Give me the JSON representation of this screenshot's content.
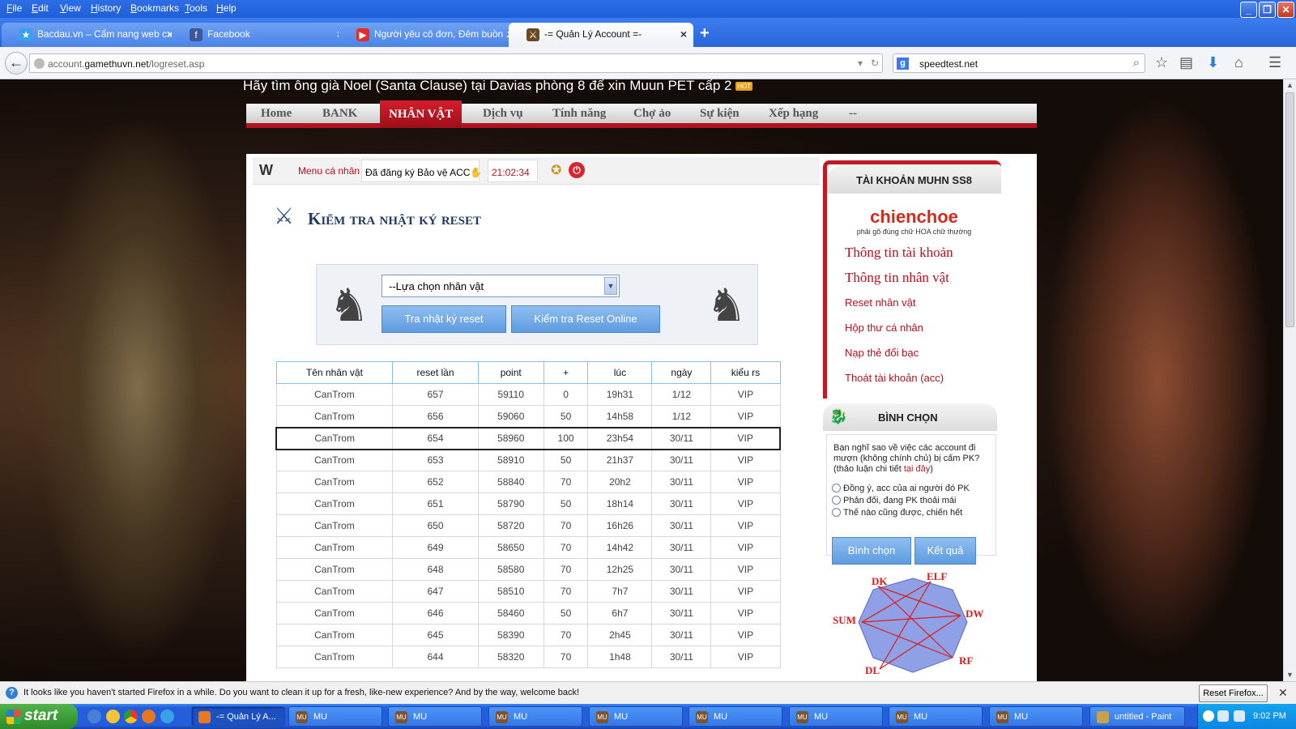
{
  "browser": {
    "menus": [
      "File",
      "Edit",
      "View",
      "History",
      "Bookmarks",
      "Tools",
      "Help"
    ],
    "tabs": [
      {
        "label": "Bacdau.vn – Cẩm nang web c...",
        "icon": "bacdau-favicon"
      },
      {
        "label": "Facebook",
        "icon": "facebook-favicon"
      },
      {
        "label": "Người yêu cô đơn, Đêm buồn ...",
        "icon": "youtube-favicon"
      },
      {
        "label": "-= Quản Lý Account =-",
        "icon": "mu-favicon",
        "active": true
      }
    ],
    "url_prefix": "account.",
    "url_host": "gamethuvn.net",
    "url_path": "/logreset.asp",
    "search_text": "speedtest.net",
    "notification": "It looks like you haven't started Firefox in a while. Do you want to clean it up for a fresh, like-new experience? And by the way, welcome back!",
    "reset_button": "Reset Firefox..."
  },
  "site": {
    "marquee": "Hãy tìm ông già Noel (Santa Clause) tại Davias phòng 8 để xin Muun PET cấp 2",
    "hot_badge": "HOT",
    "nav": [
      "Home",
      "BANK",
      "NHÂN VẬT",
      "Dịch vụ",
      "Tính năng",
      "Chợ ảo",
      "Sự kiện",
      "Xếp hạng",
      "--"
    ],
    "menu_label": "Menu cá nhân",
    "protect_status": "Đã đăng ký Bảo vệ ACC",
    "clock": "21:02:34",
    "page_title": "Kiểm tra nhật ký reset",
    "select_placeholder": "--Lựa chọn nhân vật",
    "btn_log": "Tra nhật ký reset",
    "btn_online": "Kiểm tra Reset Online",
    "table": {
      "headers": [
        "Tên nhân vật",
        "reset lần",
        "point",
        "+",
        "lúc",
        "ngày",
        "kiểu rs"
      ],
      "rows": [
        [
          "CanTrom",
          "657",
          "59110",
          "0",
          "19h31",
          "1/12",
          "VIP"
        ],
        [
          "CanTrom",
          "656",
          "59060",
          "50",
          "14h58",
          "1/12",
          "VIP"
        ],
        [
          "CanTrom",
          "654",
          "58960",
          "100",
          "23h54",
          "30/11",
          "VIP"
        ],
        [
          "CanTrom",
          "653",
          "58910",
          "50",
          "21h37",
          "30/11",
          "VIP"
        ],
        [
          "CanTrom",
          "652",
          "58840",
          "70",
          "20h2",
          "30/11",
          "VIP"
        ],
        [
          "CanTrom",
          "651",
          "58790",
          "50",
          "18h14",
          "30/11",
          "VIP"
        ],
        [
          "CanTrom",
          "650",
          "58720",
          "70",
          "16h26",
          "30/11",
          "VIP"
        ],
        [
          "CanTrom",
          "649",
          "58650",
          "70",
          "14h42",
          "30/11",
          "VIP"
        ],
        [
          "CanTrom",
          "648",
          "58580",
          "70",
          "12h25",
          "30/11",
          "VIP"
        ],
        [
          "CanTrom",
          "647",
          "58510",
          "70",
          "7h7",
          "30/11",
          "VIP"
        ],
        [
          "CanTrom",
          "646",
          "58460",
          "50",
          "6h7",
          "30/11",
          "VIP"
        ],
        [
          "CanTrom",
          "645",
          "58390",
          "70",
          "2h45",
          "30/11",
          "VIP"
        ],
        [
          "CanTrom",
          "644",
          "58320",
          "70",
          "1h48",
          "30/11",
          "VIP"
        ]
      ],
      "selected_row": 2
    },
    "account": {
      "heading": "TÀI KHOẢN MUHN SS8",
      "username": "chienchoe",
      "hint": "phải gõ đúng chữ HOA chữ thường",
      "links": [
        "Thông tin tài khoản",
        "Thông tin nhân vật",
        "Reset nhân vật",
        "Hộp thư cá nhân",
        "Nạp thẻ đổi bạc",
        "Thoát tài khoản (acc)"
      ]
    },
    "poll": {
      "heading": "BÌNH CHỌN",
      "question": "Bạn nghĩ sao về việc các account đi mượn (không chính chủ) bị cấm PK? (thảo luận chi tiết",
      "question_link": "tại đây",
      "question_end": ")",
      "options": [
        "Đồng ý, acc của ai người đó PK",
        "Phản đối, đang PK thoải mái",
        "Thế nào cũng được, chiến hết"
      ],
      "btn_vote": "Bình chọn",
      "btn_result": "Kết quả"
    },
    "class_labels": [
      "DK",
      "ELF",
      "DW",
      "RF",
      "DL",
      "SUM"
    ]
  },
  "taskbar": {
    "start": "start",
    "tasks": [
      "-= Quản Lý A...",
      "MU",
      "MU",
      "MU",
      "MU",
      "MU",
      "MU",
      "MU",
      "MU",
      "untitled - Paint"
    ],
    "clock": "9:02 PM"
  }
}
